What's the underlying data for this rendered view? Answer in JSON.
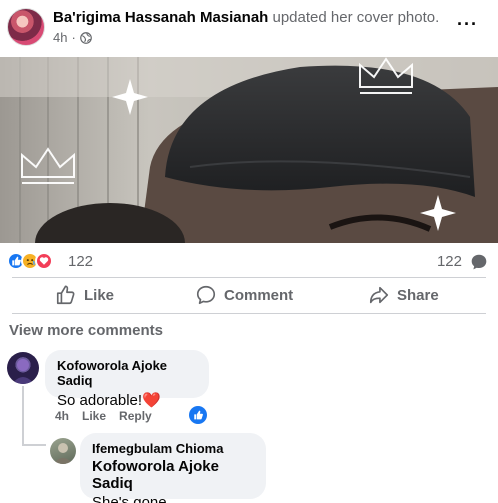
{
  "post": {
    "author": "Ba'rigima Hassanah Masianah",
    "action": "updated her cover photo.",
    "time": "4h",
    "more_icon": "more-horizontal-icon"
  },
  "reactions": {
    "types": [
      "like",
      "sad",
      "love"
    ],
    "count": "122",
    "comment_count": "122"
  },
  "actions": {
    "like": "Like",
    "comment": "Comment",
    "share": "Share"
  },
  "view_more": "View more comments",
  "comments": [
    {
      "author": "Kofoworola Ajoke Sadiq",
      "text": "So adorable!",
      "emoji": "❤️",
      "time": "4h",
      "like_label": "Like",
      "reply_label": "Reply"
    }
  ],
  "reply": {
    "author": "Ifemegbulam Chioma",
    "mention": "Kofoworola Ajoke Sadiq",
    "text": "She's gone"
  },
  "colors": {
    "facebook_blue": "#1877f2",
    "love_red": "#f33e58",
    "sad_yellow": "#f7b125",
    "bubble_bg": "#f0f2f5",
    "secondary_text": "#65676b"
  }
}
